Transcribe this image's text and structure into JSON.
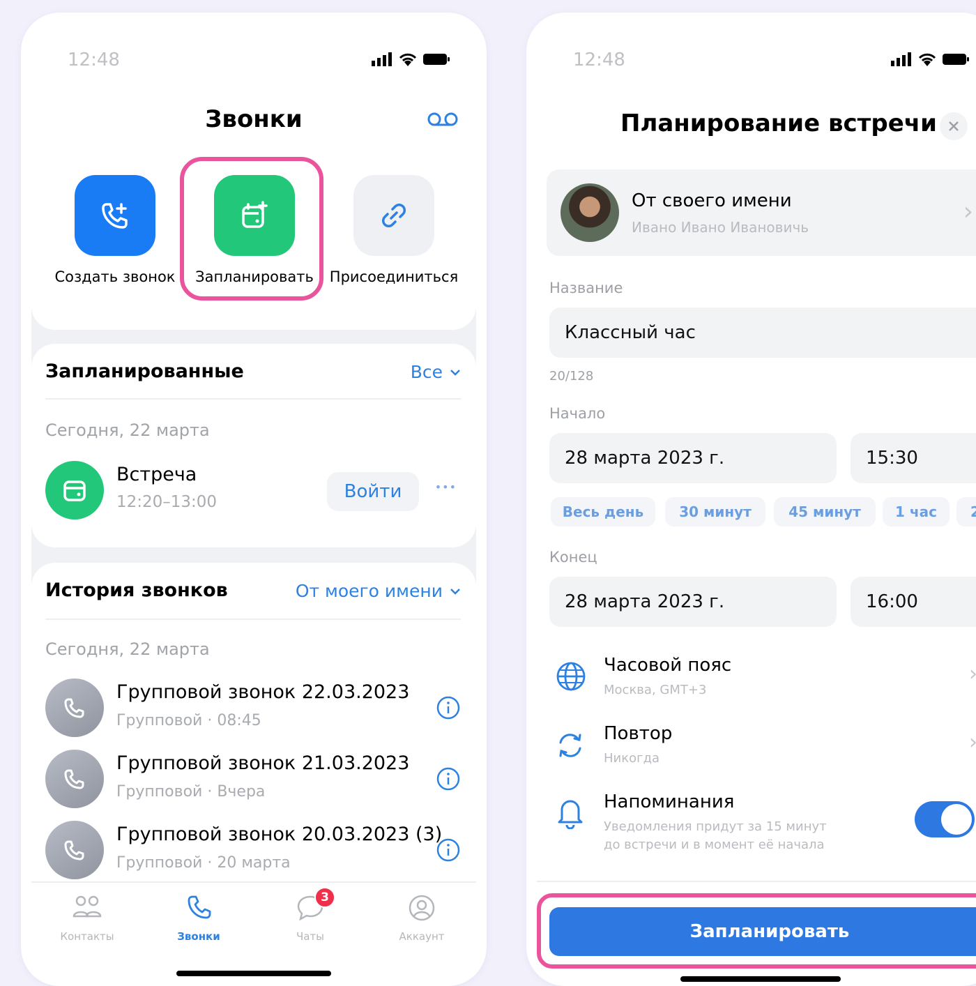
{
  "left": {
    "status_time": "12:48",
    "title": "Звонки",
    "actions": [
      {
        "label": "Создать звонок",
        "icon": "phone-plus-icon",
        "color": "#1a7cf5"
      },
      {
        "label": "Запланировать",
        "icon": "calendar-plus-icon",
        "color": "#22c77a"
      },
      {
        "label": "Присоединиться",
        "icon": "link-icon",
        "color": "#eef0f4"
      }
    ],
    "scheduled": {
      "title": "Запланированные",
      "filter": "Все",
      "date": "Сегодня, 22 марта",
      "item": {
        "title": "Встреча",
        "time": "12:20–13:00",
        "join": "Войти",
        "more": "•••"
      }
    },
    "history": {
      "title": "История звонков",
      "filter": "От моего имени",
      "date": "Сегодня, 22 марта",
      "items": [
        {
          "title": "Групповой звонок 22.03.2023",
          "sub": "Групповой · 08:45"
        },
        {
          "title": "Групповой звонок 21.03.2023",
          "sub": "Групповой · Вчера"
        },
        {
          "title": "Групповой звонок 20.03.2023 (3)",
          "sub": "Групповой · 20 марта"
        }
      ]
    },
    "tabs": [
      {
        "label": "Контакты",
        "icon": "contacts-icon"
      },
      {
        "label": "Звонки",
        "icon": "phone-icon"
      },
      {
        "label": "Чаты",
        "icon": "chat-icon",
        "badge": "3"
      },
      {
        "label": "Аккаунт",
        "icon": "account-icon"
      }
    ]
  },
  "right": {
    "status_time": "12:48",
    "title": "Планирование встречи",
    "identity": {
      "title": "От своего имени",
      "name": "Ивано Ивано Ивановичь"
    },
    "name_label": "Название",
    "name_value": "Классный час",
    "name_counter": "20/128",
    "start_label": "Начало",
    "start_date": "28 марта 2023 г.",
    "start_time": "15:30",
    "durations": [
      "Весь день",
      "30 минут",
      "45 минут",
      "1 час",
      "2"
    ],
    "end_label": "Конец",
    "end_date": "28 марта 2023 г.",
    "end_time": "16:00",
    "timezone": {
      "title": "Часовой пояс",
      "sub": "Москва, GMT+3"
    },
    "repeat": {
      "title": "Повтор",
      "sub": "Никогда"
    },
    "reminders": {
      "title": "Напоминания",
      "sub1": "Уведомления придут за 15 минут",
      "sub2": "до встречи и в момент её начала",
      "enabled": true
    },
    "submit": "Запланировать"
  },
  "colors": {
    "accent": "#2e78e2",
    "highlight": "#e9549c",
    "green": "#22c77a",
    "badge": "#f0304b"
  }
}
